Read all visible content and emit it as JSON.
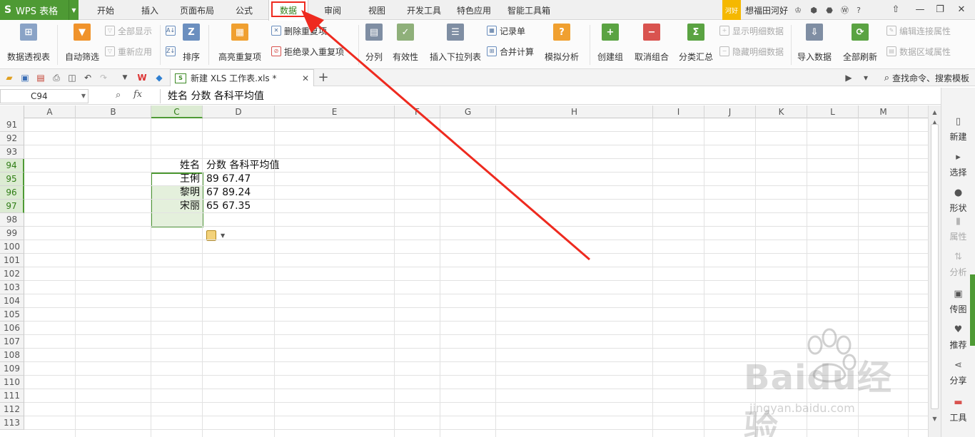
{
  "app": {
    "name": "WPS 表格",
    "logo": "S"
  },
  "menu": {
    "tabs": [
      {
        "label": "开始"
      },
      {
        "label": "插入"
      },
      {
        "label": "页面布局"
      },
      {
        "label": "公式"
      },
      {
        "label": "数据"
      },
      {
        "label": "审阅"
      },
      {
        "label": "视图"
      },
      {
        "label": "开发工具"
      },
      {
        "label": "特色应用"
      },
      {
        "label": "智能工具箱"
      }
    ],
    "active": "数据",
    "user": {
      "badge": "河好",
      "name": "想福田河好"
    },
    "help": "?"
  },
  "ribbon": {
    "pivot": "数据透视表",
    "auto_filter": "自动筛选",
    "show_all": "全部显示",
    "reapply": "重新应用",
    "sort": "排序",
    "highlight_dup": "高亮重复项",
    "delete_dup": "删除重复项",
    "reject_dup": "拒绝录入重复项",
    "split": "分列",
    "validity": "有效性",
    "insert_dropdown": "插入下拉列表",
    "record_form": "记录单",
    "consolidate": "合并计算",
    "what_if": "模拟分析",
    "create_group": "创建组",
    "ungroup": "取消组合",
    "subtotal": "分类汇总",
    "show_detail": "显示明细数据",
    "hide_detail": "隐藏明细数据",
    "import_data": "导入数据",
    "refresh_all": "全部刷新",
    "edit_conn": "编辑连接属性",
    "range_props": "数据区域属性"
  },
  "quickbar": {
    "doc_tab_title": "新建 XLS 工作表.xls *",
    "search_commands": "查找命令、搜索模板"
  },
  "formula": {
    "cell_ref": "C94",
    "fx": "fx",
    "content": "姓名  分数  各科平均值"
  },
  "grid": {
    "columns": [
      "A",
      "B",
      "C",
      "D",
      "E",
      "F",
      "G",
      "H",
      "I",
      "J",
      "K",
      "L",
      "M"
    ],
    "selected_column": "C",
    "rows": [
      "91",
      "92",
      "93",
      "94",
      "95",
      "96",
      "97",
      "98",
      "99",
      "100",
      "101",
      "102",
      "103",
      "104",
      "105",
      "106",
      "107",
      "108",
      "109",
      "110",
      "111",
      "112",
      "113"
    ],
    "selected_rows": [
      "94",
      "95",
      "96",
      "97"
    ],
    "data": [
      {
        "row": "94",
        "c": "姓名",
        "d": "分数  各科平均值"
      },
      {
        "row": "95",
        "c": "王俐",
        "d": "89  67.47"
      },
      {
        "row": "96",
        "c": "黎明",
        "d": "67  89.24"
      },
      {
        "row": "97",
        "c": "宋丽",
        "d": "65  67.35"
      }
    ]
  },
  "sidepane": {
    "items": [
      {
        "label": "新建",
        "icon": "new-file-icon",
        "enabled": true
      },
      {
        "label": "选择",
        "icon": "select-icon",
        "enabled": true
      },
      {
        "label": "形状",
        "icon": "shape-icon",
        "enabled": true
      },
      {
        "label": "属性",
        "icon": "properties-icon",
        "enabled": false
      },
      {
        "label": "分析",
        "icon": "analysis-icon",
        "enabled": false
      },
      {
        "label": "传图",
        "icon": "upload-image-icon",
        "enabled": true
      },
      {
        "label": "推荐",
        "icon": "recommend-icon",
        "enabled": true
      },
      {
        "label": "分享",
        "icon": "share-icon",
        "enabled": true
      },
      {
        "label": "工具",
        "icon": "toolbox-icon",
        "enabled": true
      }
    ]
  },
  "watermark": {
    "logo": "Baidu经验",
    "url": "jingyan.baidu.com"
  },
  "colors": {
    "accent": "#4e9a34",
    "annotation": "#ee2a1f",
    "selection_fill": "#e4f0dc"
  }
}
